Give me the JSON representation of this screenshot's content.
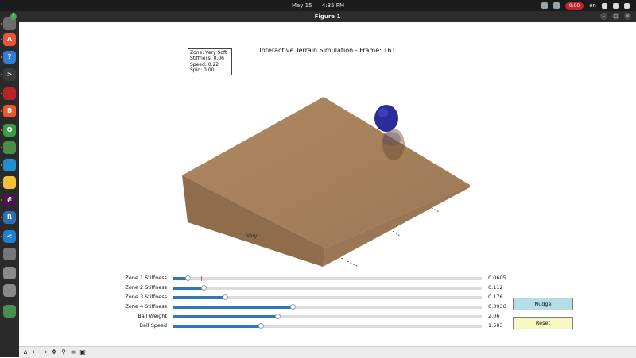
{
  "system_bar": {
    "date": "May 15",
    "time": "4:35 PM",
    "recording": "0:00",
    "language": "en"
  },
  "window": {
    "title": "Figure 1"
  },
  "dock": {
    "badge_count": "1",
    "items": [
      {
        "name": "files-icon",
        "color": "#6d6d6d",
        "glyph": ""
      },
      {
        "name": "app-store-icon",
        "color": "#e9553b",
        "glyph": "A"
      },
      {
        "name": "help-icon",
        "color": "#2d7fd3",
        "glyph": "?"
      },
      {
        "name": "terminal-icon",
        "color": "#3a3a3a",
        "glyph": ">"
      },
      {
        "name": "screen-recorder-icon",
        "color": "#b3252a",
        "glyph": ""
      },
      {
        "name": "brave-icon",
        "color": "#f1562b",
        "glyph": "B"
      },
      {
        "name": "chrome-icon",
        "color": "#3b9a45",
        "glyph": "O"
      },
      {
        "name": "package-manager-icon",
        "color": "#4c8c4a",
        "glyph": ""
      },
      {
        "name": "remote-desktop-icon",
        "color": "#1f8fd0",
        "glyph": ""
      },
      {
        "name": "notes-icon",
        "color": "#f0c038",
        "glyph": ""
      },
      {
        "name": "slack-icon",
        "color": "#4a154b",
        "glyph": "#"
      },
      {
        "name": "remmina-icon",
        "color": "#2a6fb9",
        "glyph": "R"
      },
      {
        "name": "vscode-icon",
        "color": "#1e7fd2",
        "glyph": "<"
      },
      {
        "name": "settings-icon",
        "color": "#777777",
        "glyph": ""
      },
      {
        "name": "disk-icon",
        "color": "#8a8a8a",
        "glyph": ""
      },
      {
        "name": "drive-icon",
        "color": "#8a8a8a",
        "glyph": ""
      },
      {
        "name": "trash-icon",
        "color": "#4b8f4f",
        "glyph": ""
      },
      {
        "name": "ubuntu-logo-icon",
        "color": "#2a2a2a",
        "glyph": ""
      }
    ]
  },
  "plot": {
    "title": "Interactive Terrain Simulation - Frame: 161",
    "info": {
      "zone": "Zone: Very Soft",
      "stiffness": "Stiffness: 0.06",
      "speed": "Speed: 0.22",
      "spin": "Spin: 0.00"
    },
    "hidden_label": "Very"
  },
  "colors": {
    "terrain_top": "#a7825d",
    "terrain_side": "#8f6d4c",
    "ball": "#2a2d99",
    "slider_fill": "#2e78b5"
  },
  "sliders": [
    {
      "label": "Zone 1 Stiffness",
      "value": "0.0605",
      "fill": 0.048,
      "init": 0.09
    },
    {
      "label": "Zone 2 Stiffness",
      "value": "0.112",
      "fill": 0.1,
      "init": 0.4
    },
    {
      "label": "Zone 3 Stiffness",
      "value": "0.176",
      "fill": 0.17,
      "init": 0.7
    },
    {
      "label": "Zone 4 Stiffness",
      "value": "0.3936",
      "fill": 0.39,
      "init": 0.95
    },
    {
      "label": "Ball Weight",
      "value": "2.06",
      "fill": 0.34,
      "init": null
    },
    {
      "label": "Ball Speed",
      "value": "1.503",
      "fill": 0.285,
      "init": null
    }
  ],
  "buttons": {
    "nudge": "Nudge",
    "reset": "Reset"
  },
  "toolbar": [
    "home-icon",
    "back-icon",
    "forward-icon",
    "pan-icon",
    "zoom-icon",
    "configure-icon",
    "save-icon"
  ]
}
